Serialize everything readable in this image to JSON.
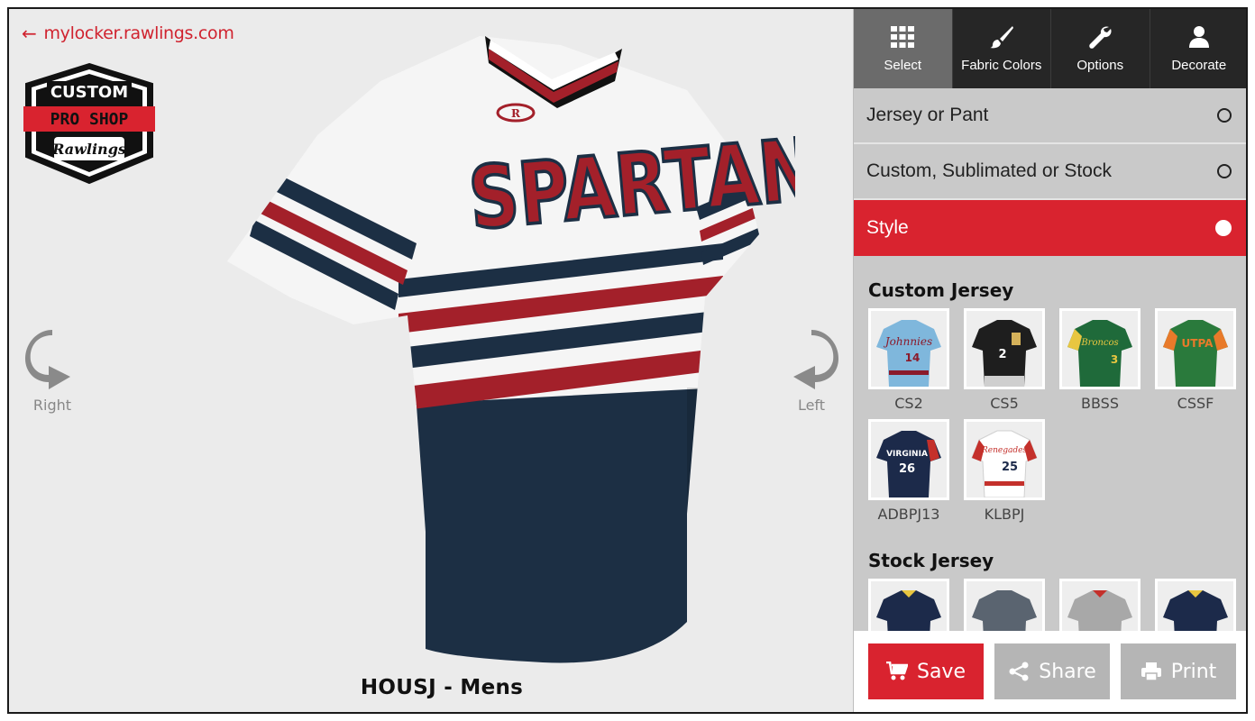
{
  "viewer": {
    "back_link": "mylocker.rawlings.com",
    "logo": {
      "line1": "CUSTOM",
      "line2": "PRO SHOP",
      "line3": "Rawlings"
    },
    "rotate_right": "Right",
    "rotate_left": "Left",
    "jersey_text": "SPARTANS",
    "product_title": "HOUSJ - Mens"
  },
  "toolbar": [
    {
      "label": "Select",
      "icon": "grid-icon"
    },
    {
      "label": "Fabric Colors",
      "icon": "brush-icon"
    },
    {
      "label": "Options",
      "icon": "wrench-icon"
    },
    {
      "label": "Decorate",
      "icon": "person-icon"
    }
  ],
  "steps": [
    {
      "label": "Jersey or Pant"
    },
    {
      "label": "Custom, Sublimated or Stock"
    },
    {
      "label": "Style"
    }
  ],
  "custom_jersey": {
    "title": "Custom Jersey",
    "items": [
      {
        "code": "CS2",
        "number": "14",
        "text": "Johnnies"
      },
      {
        "code": "CS5",
        "number": "2",
        "text": ""
      },
      {
        "code": "BBSS",
        "number": "3",
        "text": "Broncos"
      },
      {
        "code": "CSSF",
        "number": "",
        "text": "UTPA"
      },
      {
        "code": "ADBPJ13",
        "number": "26",
        "text": "VIRGINIA"
      },
      {
        "code": "KLBPJ",
        "number": "25",
        "text": "Renegades"
      }
    ]
  },
  "stock_jersey": {
    "title": "Stock Jersey"
  },
  "actions": {
    "save": "Save",
    "share": "Share",
    "print": "Print"
  },
  "colors": {
    "accent": "#d9232f",
    "navy": "#1c2f44",
    "red": "#a3202a",
    "toolbar": "#262626"
  }
}
